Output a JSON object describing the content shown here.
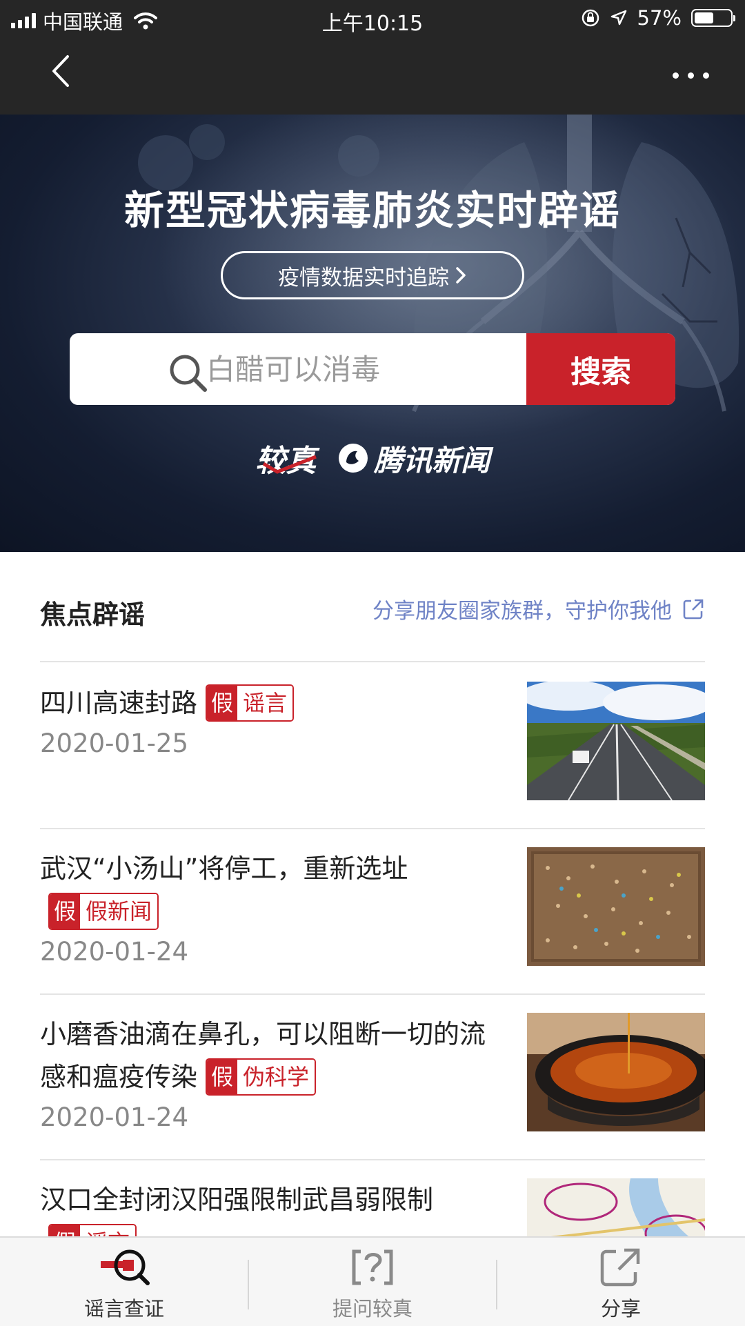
{
  "status_bar": {
    "carrier": "中国联通",
    "time": "上午10:15",
    "battery": "57%",
    "battery_level": 0.57
  },
  "nav": {
    "back_icon": "chevron-left-icon",
    "more_icon": "more-dots-icon"
  },
  "hero": {
    "title": "新型冠状病毒肺炎实时辟谣",
    "track_button": "疫情数据实时追踪",
    "search": {
      "placeholder": "白醋可以消毒",
      "button": "搜索"
    },
    "brand_logo_1": "较真",
    "brand_logo_2": "腾讯新闻"
  },
  "section": {
    "title": "焦点辟谣",
    "share_link": "分享朋友圈家族群，守护你我他"
  },
  "items": [
    {
      "headline": "四川高速封路",
      "tag_prefix": "假",
      "tag": "谣言",
      "date": "2020-01-25"
    },
    {
      "headline": "武汉“小汤山”将停工，重新选址",
      "tag_prefix": "假",
      "tag": "假新闻",
      "date": "2020-01-24"
    },
    {
      "headline": "小磨香油滴在鼻孔，可以阻断一切的流感和瘟疫传染",
      "tag_prefix": "假",
      "tag": "伪科学",
      "date": "2020-01-24"
    },
    {
      "headline": "汉口全封闭汉阳强限制武昌弱限制",
      "tag_prefix": "假",
      "tag": "谣言",
      "date": ""
    }
  ],
  "tabbar": [
    {
      "label": "谣言查证",
      "icon": "search-check-icon",
      "active": true
    },
    {
      "label": "提问较真",
      "icon": "question-icon",
      "active": false
    },
    {
      "label": "分享",
      "icon": "share-icon",
      "active": false
    }
  ],
  "colors": {
    "accent_red": "#c9222a",
    "link_blue": "#6f83c6",
    "nav_bg": "#262626"
  }
}
